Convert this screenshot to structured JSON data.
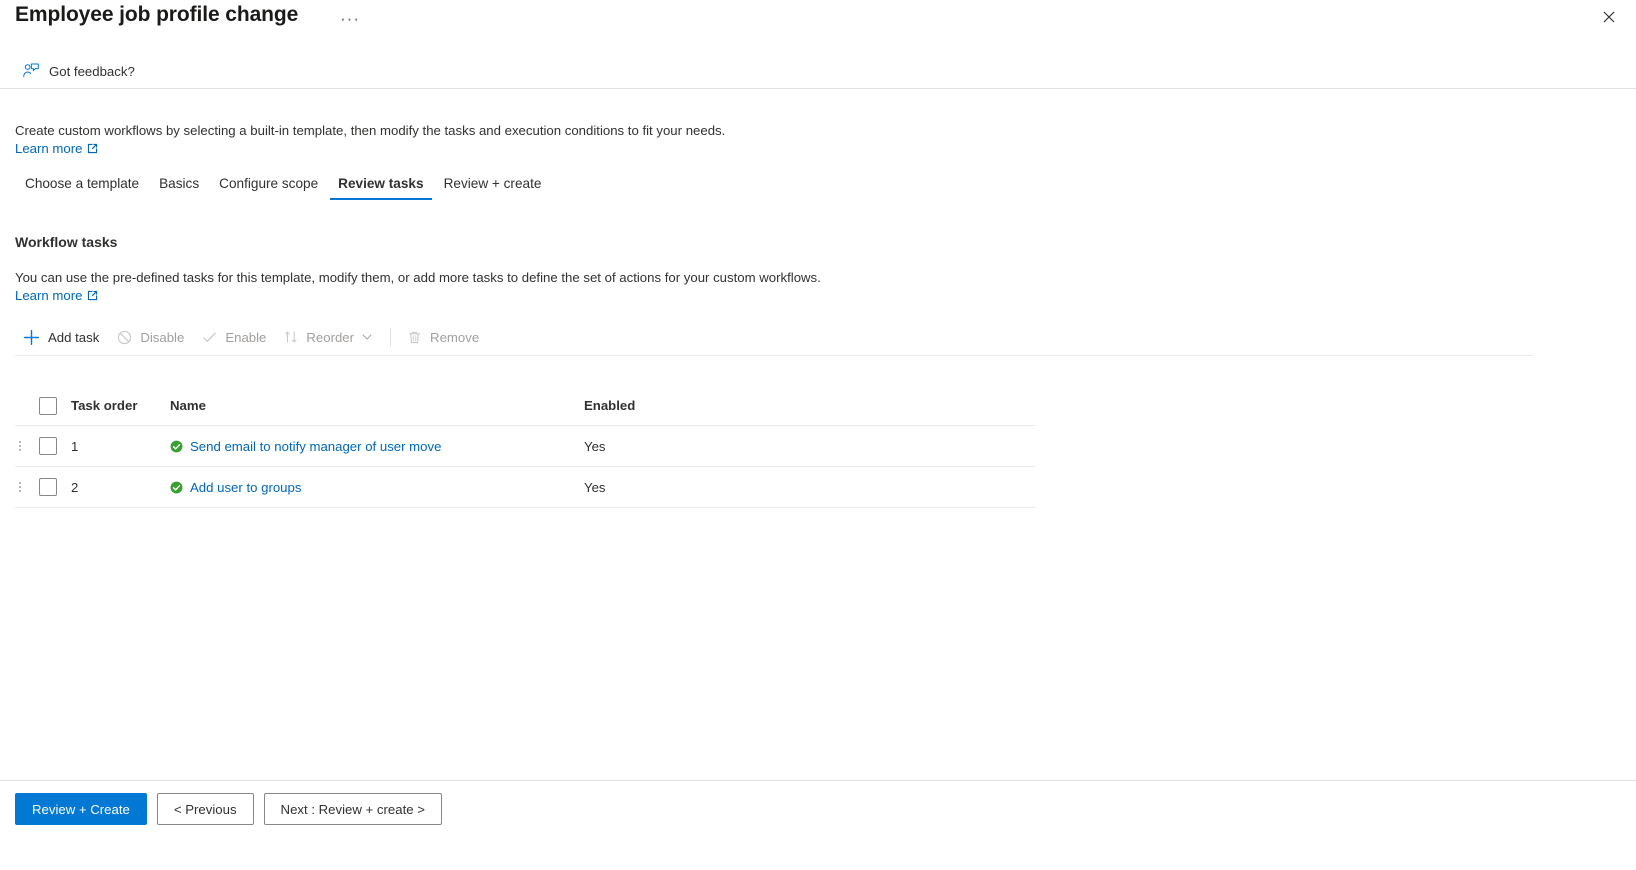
{
  "blade": {
    "title": "Employee job profile change",
    "ellipsis_label": "···",
    "close_label": "Close"
  },
  "feedback": {
    "label": "Got feedback?",
    "icon": "feedback-person-icon"
  },
  "intro": {
    "text": "Create custom workflows by selecting a built-in template, then modify the tasks and execution conditions to fit your needs.",
    "learn_more": "Learn more"
  },
  "tabs": [
    {
      "label": "Choose a template",
      "active": false
    },
    {
      "label": "Basics",
      "active": false
    },
    {
      "label": "Configure scope",
      "active": false
    },
    {
      "label": "Review tasks",
      "active": true
    },
    {
      "label": "Review + create",
      "active": false
    }
  ],
  "section": {
    "title": "Workflow tasks",
    "description": "You can use the pre-defined tasks for this template, modify them, or add more tasks to define the set of actions for your custom workflows.",
    "learn_more": "Learn more"
  },
  "commandbar": [
    {
      "label": "Add task",
      "icon": "plus-icon",
      "disabled": false
    },
    {
      "label": "Disable",
      "icon": "block-icon",
      "disabled": true
    },
    {
      "label": "Enable",
      "icon": "check-icon",
      "disabled": true
    },
    {
      "label": "Reorder",
      "icon": "sort-arrows-icon",
      "disabled": true,
      "has_chevron": true
    },
    {
      "label": "Remove",
      "icon": "trash-icon",
      "disabled": true
    }
  ],
  "table": {
    "columns": [
      "Task order",
      "Name",
      "Enabled"
    ],
    "select_all_checked": false,
    "rows": [
      {
        "order": "1",
        "name": "Send email to notify manager of user move",
        "enabled": "Yes",
        "status_icon": "green-check-circle-icon",
        "checked": false
      },
      {
        "order": "2",
        "name": "Add user to groups",
        "enabled": "Yes",
        "status_icon": "green-check-circle-icon",
        "checked": false
      }
    ]
  },
  "footer": {
    "primary": "Review + Create",
    "previous": "< Previous",
    "next": "Next : Review + create >"
  },
  "colors": {
    "accent": "#0078d4",
    "link": "#0067b8",
    "success": "#3aa033",
    "text": "#323130",
    "disabled": "#a19f9d",
    "border": "#e1dfdd"
  }
}
